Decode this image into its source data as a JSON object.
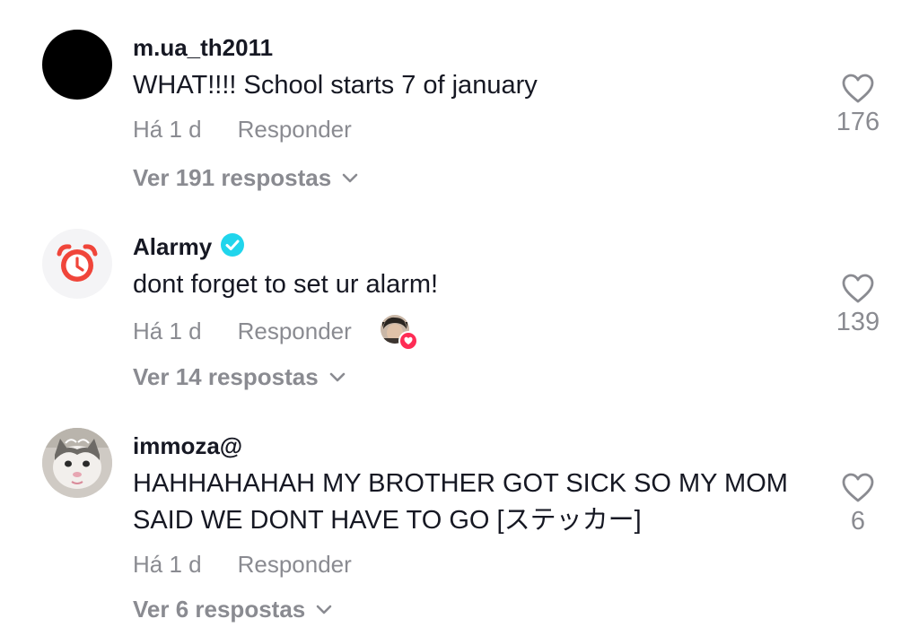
{
  "comments": [
    {
      "username": "m.ua_th2011",
      "text": "WHAT!!!! School starts 7 of january",
      "time": "Há 1 d",
      "reply_label": "Responder",
      "view_replies": "Ver 191 respostas",
      "likes": "176",
      "verified": false,
      "avatar": "black-circle"
    },
    {
      "username": "Alarmy",
      "text": "dont forget to set ur alarm!",
      "time": "Há 1 d",
      "reply_label": "Responder",
      "view_replies": "Ver 14 respostas",
      "likes": "139",
      "verified": true,
      "creator_liked": true,
      "avatar": "alarm-clock-logo"
    },
    {
      "username": "immoza@",
      "text": "HAHHAHAHAH MY BROTHER GOT SICK SO MY MOM SAID WE DONT HAVE TO GO [ステッカー]",
      "time": "Há 1 d",
      "reply_label": "Responder",
      "view_replies": "Ver 6 respostas",
      "likes": "6",
      "verified": false,
      "avatar": "cat-photo"
    }
  ],
  "colors": {
    "primary_text": "#161823",
    "secondary_text": "#8a8b91",
    "verified_badge": "#20d5ec",
    "like_badge": "#fe2c55",
    "alarmy_red": "#f0453a"
  },
  "icons": {
    "like": "heart-outline-icon",
    "expand": "chevron-down-icon",
    "verified": "verified-badge-icon"
  }
}
